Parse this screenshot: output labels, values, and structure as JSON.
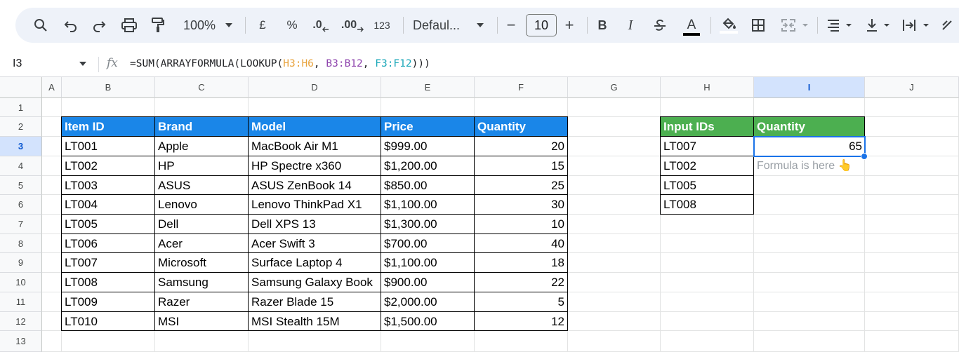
{
  "toolbar": {
    "zoom": "100%",
    "currency": "£",
    "percent": "%",
    "decrease_decimal": ".0",
    "increase_decimal": ".00",
    "number_format": "123",
    "font": "Defaul...",
    "font_size": "10",
    "minus": "−",
    "plus": "+",
    "bold": "B",
    "italic": "I",
    "text_color_letter": "A"
  },
  "formula_bar": {
    "cell_ref": "I3",
    "fx": "fx",
    "formula_prefix": "=SUM(ARRAYFORMULA(LOOKUP(",
    "ref1": "H3:H6",
    "sep1": ", ",
    "ref2": "B3:B12",
    "sep2": ", ",
    "ref3": "F3:F12",
    "formula_suffix": ")))"
  },
  "columns": [
    "A",
    "B",
    "C",
    "D",
    "E",
    "F",
    "G",
    "H",
    "I",
    "J"
  ],
  "rows": [
    "1",
    "2",
    "3",
    "4",
    "5",
    "6",
    "7",
    "8",
    "9",
    "10",
    "11",
    "12",
    "13"
  ],
  "selected_cell": {
    "column": "I",
    "row": "3"
  },
  "main_table": {
    "headers": [
      "Item ID",
      "Brand",
      "Model",
      "Price",
      "Quantity"
    ],
    "rows": [
      [
        "LT001",
        "Apple",
        "MacBook Air M1",
        "$999.00",
        "20"
      ],
      [
        "LT002",
        "HP",
        "HP Spectre x360",
        "$1,200.00",
        "15"
      ],
      [
        "LT003",
        "ASUS",
        "ASUS ZenBook 14",
        "$850.00",
        "25"
      ],
      [
        "LT004",
        "Lenovo",
        "Lenovo ThinkPad X1",
        "$1,100.00",
        "30"
      ],
      [
        "LT005",
        "Dell",
        "Dell XPS 13",
        "$1,300.00",
        "10"
      ],
      [
        "LT006",
        "Acer",
        "Acer Swift 3",
        "$700.00",
        "40"
      ],
      [
        "LT007",
        "Microsoft",
        "Surface Laptop 4",
        "$1,100.00",
        "18"
      ],
      [
        "LT008",
        "Samsung",
        "Samsung Galaxy Book",
        "$900.00",
        "22"
      ],
      [
        "LT009",
        "Razer",
        "Razer Blade 15",
        "$2,000.00",
        "5"
      ],
      [
        "LT010",
        "MSI",
        "MSI Stealth 15M",
        "$1,500.00",
        "12"
      ]
    ]
  },
  "lookup_table": {
    "headers": [
      "Input IDs",
      "Quantity"
    ],
    "ids": [
      "LT007",
      "LT002",
      "LT005",
      "LT008"
    ],
    "result": "65",
    "hint": "Formula is here 👆"
  },
  "colors": {
    "header_blue": "#1a86e8",
    "header_green": "#4caf50",
    "selection": "#1a73e8"
  }
}
